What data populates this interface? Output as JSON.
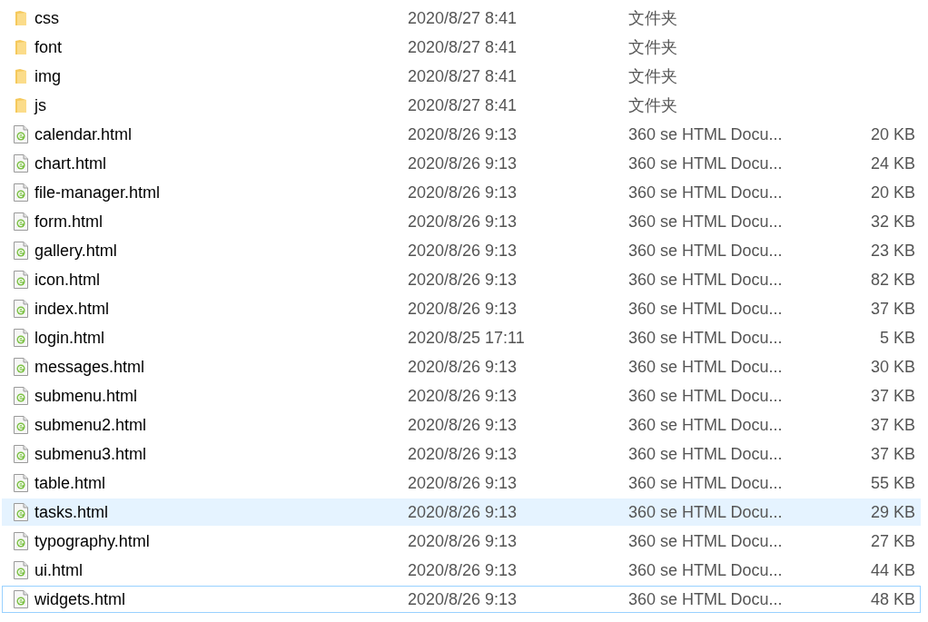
{
  "files": [
    {
      "kind": "folder",
      "name": "css",
      "modified": "2020/8/27 8:41",
      "type": "文件夹",
      "hovered": false,
      "focused": false
    },
    {
      "kind": "folder",
      "name": "font",
      "modified": "2020/8/27 8:41",
      "type": "文件夹",
      "hovered": false,
      "focused": false
    },
    {
      "kind": "folder",
      "name": "img",
      "modified": "2020/8/27 8:41",
      "type": "文件夹",
      "hovered": false,
      "focused": false
    },
    {
      "kind": "folder",
      "name": "js",
      "modified": "2020/8/27 8:41",
      "type": "文件夹",
      "hovered": false,
      "focused": false
    },
    {
      "kind": "file",
      "name": "calendar.html",
      "modified": "2020/8/26 9:13",
      "type": "360 se HTML Docu...",
      "size": "20 KB",
      "hovered": false,
      "focused": false
    },
    {
      "kind": "file",
      "name": "chart.html",
      "modified": "2020/8/26 9:13",
      "type": "360 se HTML Docu...",
      "size": "24 KB",
      "hovered": false,
      "focused": false
    },
    {
      "kind": "file",
      "name": "file-manager.html",
      "modified": "2020/8/26 9:13",
      "type": "360 se HTML Docu...",
      "size": "20 KB",
      "hovered": false,
      "focused": false
    },
    {
      "kind": "file",
      "name": "form.html",
      "modified": "2020/8/26 9:13",
      "type": "360 se HTML Docu...",
      "size": "32 KB",
      "hovered": false,
      "focused": false
    },
    {
      "kind": "file",
      "name": "gallery.html",
      "modified": "2020/8/26 9:13",
      "type": "360 se HTML Docu...",
      "size": "23 KB",
      "hovered": false,
      "focused": false
    },
    {
      "kind": "file",
      "name": "icon.html",
      "modified": "2020/8/26 9:13",
      "type": "360 se HTML Docu...",
      "size": "82 KB",
      "hovered": false,
      "focused": false
    },
    {
      "kind": "file",
      "name": "index.html",
      "modified": "2020/8/26 9:13",
      "type": "360 se HTML Docu...",
      "size": "37 KB",
      "hovered": false,
      "focused": false
    },
    {
      "kind": "file",
      "name": "login.html",
      "modified": "2020/8/25 17:11",
      "type": "360 se HTML Docu...",
      "size": "5 KB",
      "hovered": false,
      "focused": false
    },
    {
      "kind": "file",
      "name": "messages.html",
      "modified": "2020/8/26 9:13",
      "type": "360 se HTML Docu...",
      "size": "30 KB",
      "hovered": false,
      "focused": false
    },
    {
      "kind": "file",
      "name": "submenu.html",
      "modified": "2020/8/26 9:13",
      "type": "360 se HTML Docu...",
      "size": "37 KB",
      "hovered": false,
      "focused": false
    },
    {
      "kind": "file",
      "name": "submenu2.html",
      "modified": "2020/8/26 9:13",
      "type": "360 se HTML Docu...",
      "size": "37 KB",
      "hovered": false,
      "focused": false
    },
    {
      "kind": "file",
      "name": "submenu3.html",
      "modified": "2020/8/26 9:13",
      "type": "360 se HTML Docu...",
      "size": "37 KB",
      "hovered": false,
      "focused": false
    },
    {
      "kind": "file",
      "name": "table.html",
      "modified": "2020/8/26 9:13",
      "type": "360 se HTML Docu...",
      "size": "55 KB",
      "hovered": false,
      "focused": false
    },
    {
      "kind": "file",
      "name": "tasks.html",
      "modified": "2020/8/26 9:13",
      "type": "360 se HTML Docu...",
      "size": "29 KB",
      "hovered": true,
      "focused": false
    },
    {
      "kind": "file",
      "name": "typography.html",
      "modified": "2020/8/26 9:13",
      "type": "360 se HTML Docu...",
      "size": "27 KB",
      "hovered": false,
      "focused": false
    },
    {
      "kind": "file",
      "name": "ui.html",
      "modified": "2020/8/26 9:13",
      "type": "360 se HTML Docu...",
      "size": "44 KB",
      "hovered": false,
      "focused": false
    },
    {
      "kind": "file",
      "name": "widgets.html",
      "modified": "2020/8/26 9:13",
      "type": "360 se HTML Docu...",
      "size": "48 KB",
      "hovered": false,
      "focused": true
    }
  ]
}
